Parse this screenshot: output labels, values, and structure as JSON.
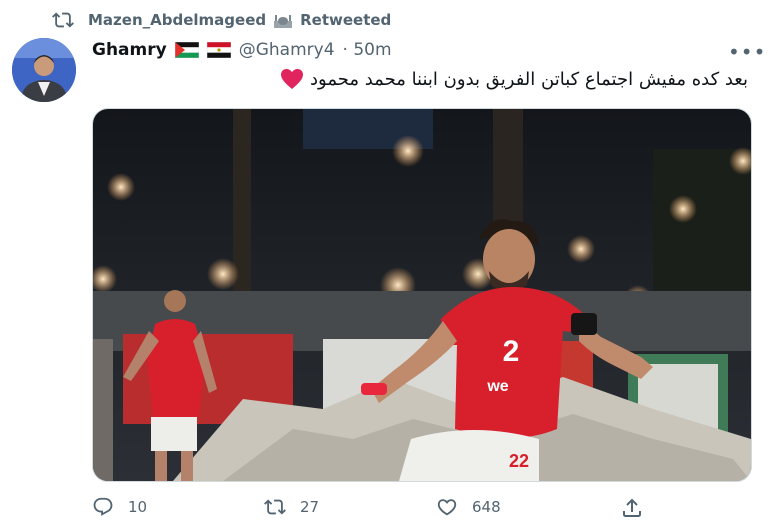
{
  "retweet": {
    "user": "Mazen_Abdelmageed",
    "label": "Retweeted"
  },
  "tweet": {
    "name": "Ghamry",
    "handle": "@Ghamry4",
    "time": "· 50m",
    "text": "بعد كده مفيش اجتماع كباتن الفريق بدون ابننا محمد محمود"
  },
  "actions": {
    "replies": "10",
    "retweets": "27",
    "likes": "648"
  },
  "image": {
    "jersey_numbers": [
      "22"
    ],
    "sponsor": "we"
  },
  "colors": {
    "text": "#0f1419",
    "secondary": "#536471",
    "heart": "#e0245e",
    "jersey": "#d7202b"
  },
  "icons": [
    "retweet-icon",
    "more-icon",
    "heart-emoji-icon",
    "reply-icon",
    "like-icon",
    "share-icon"
  ]
}
